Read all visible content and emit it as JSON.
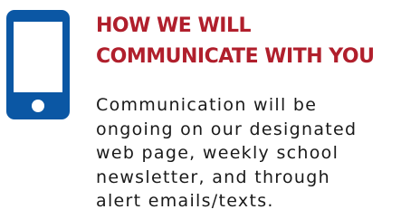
{
  "icon": {
    "name": "smartphone-icon",
    "color": "#0b57a4"
  },
  "heading": {
    "line1": "HOW WE WILL",
    "line2": "COMMUNICATE WITH YOU",
    "color": "#b01f2c"
  },
  "body": {
    "lines": [
      "Communication will be",
      "ongoing on our designated",
      "web page, weekly school",
      "newsletter, and through",
      "alert emails/texts."
    ]
  }
}
